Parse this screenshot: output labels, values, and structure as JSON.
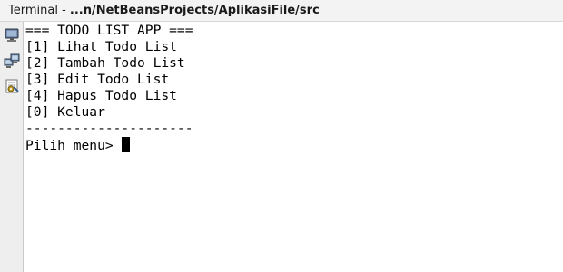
{
  "window": {
    "title_prefix": "Terminal - ",
    "title_path": "...n/NetBeansProjects/AplikasiFile/src"
  },
  "toolbar": {
    "buttons": [
      {
        "icon": "monitor-icon"
      },
      {
        "icon": "network-computers-icon"
      },
      {
        "icon": "settings-document-icon"
      }
    ]
  },
  "terminal": {
    "lines": [
      "=== TODO LIST APP ===",
      "[1] Lihat Todo List",
      "[2] Tambah Todo List",
      "[3] Edit Todo List",
      "[4] Hapus Todo List",
      "[0] Keluar",
      "---------------------"
    ],
    "prompt": "Pilih menu> "
  }
}
